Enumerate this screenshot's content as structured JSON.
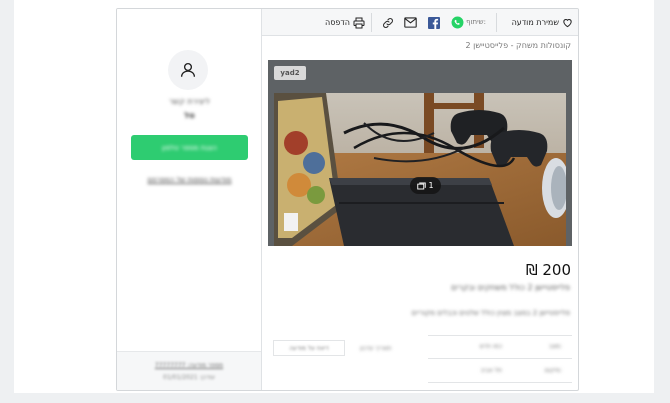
{
  "toolbar": {
    "save_label": "שמירת מודעה",
    "share_label": "שיתוף:",
    "print_label": "הדפסה"
  },
  "breadcrumb": "קונסולות משחק - פלייסטיישן 2",
  "gallery": {
    "logo_text": "yad2",
    "image_count": "1"
  },
  "listing": {
    "price": "200 ₪",
    "subtitle": "פלייסטיישן 2 כולל משחקים ובקרים",
    "description": "פלייסטיישן 2 במצב מצוין כולל שלטים וכבלים מקוריים",
    "details": [
      {
        "label": "מצב:",
        "value": "כמו חדש"
      },
      {
        "label": "מיקום:",
        "value": "תל אביב"
      }
    ],
    "secondary_label": "תאריך עדכון",
    "secondary_button": "דיווח על מודעה"
  },
  "seller": {
    "title": "ליצירת קשר",
    "name": "טל",
    "phone_button": "הצגת מספר טלפון",
    "more_link": "מודעות נוספות של המפרסם",
    "footer_link": "מספר מודעה: 77777777",
    "footer_date": "עודכן: 01/01/2021"
  },
  "colors": {
    "accent_green": "#2ecc71",
    "whatsapp": "#25d366",
    "facebook": "#3b5998"
  }
}
